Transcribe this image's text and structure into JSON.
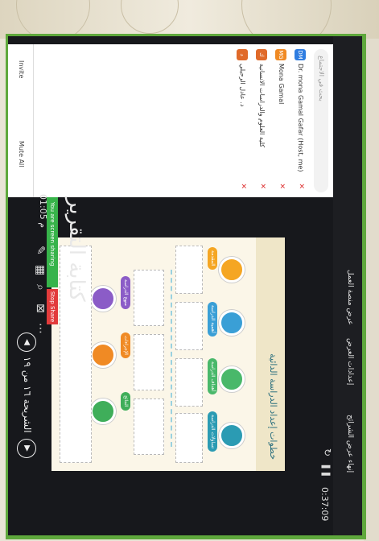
{
  "topbar": {
    "time": "0:37:09",
    "items": [
      "عرض منصة العمل",
      "إعدادات العرض",
      "إنهاء عرض الشرائح"
    ],
    "pause_icon": "pause-icon",
    "refresh_icon": "refresh-icon"
  },
  "sidebar": {
    "search_placeholder": "بحث في الاجتماع",
    "participants": [
      {
        "initials": "DM",
        "name": "Dr. mona Gamal Gafar (Host, me)",
        "color": "#2f7de1"
      },
      {
        "initials": "MG",
        "name": "Mona Gamal",
        "color": "#f08a24"
      },
      {
        "initials": "ك",
        "name": "كلية العلوم والدراسات الانسانية",
        "color": "#e06a2a"
      },
      {
        "initials": "د",
        "name": "د. عادل الرحيلي",
        "color": "#e06a2a"
      }
    ],
    "invite_label": "Invite",
    "mute_all_label": "Mute All"
  },
  "slide": {
    "title": "خطوات إعداد الدراسة الدائية",
    "calligraphy": "كتابة التقرير",
    "slide_time": "01:05 م",
    "steps": [
      {
        "label": "المقدمة",
        "color": "#f5a623"
      },
      {
        "label": "أهمية الدراسة",
        "color": "#3a9fd6"
      },
      {
        "label": "أهداف الدراسة",
        "color": "#49b86a"
      },
      {
        "label": "تساؤلات الدراسة",
        "color": "#2b9bb3"
      },
      {
        "label": "منهج الدراسة",
        "color": "#8b5cc7"
      },
      {
        "label": "الإجراءات",
        "color": "#f08a24"
      },
      {
        "label": "النتائج",
        "color": "#3fae5a"
      }
    ]
  },
  "share": {
    "status": "You are screen sharing",
    "stop_label": "Stop Share"
  },
  "navigation": {
    "slide_counter": "الشريحة ١٦ من ١٩",
    "prev_icon": "chevron-left-icon",
    "next_icon": "chevron-right-icon"
  },
  "colors": {
    "frame": "#5fa83c",
    "screen": "#17181c",
    "accent": "#2b6f7e"
  }
}
